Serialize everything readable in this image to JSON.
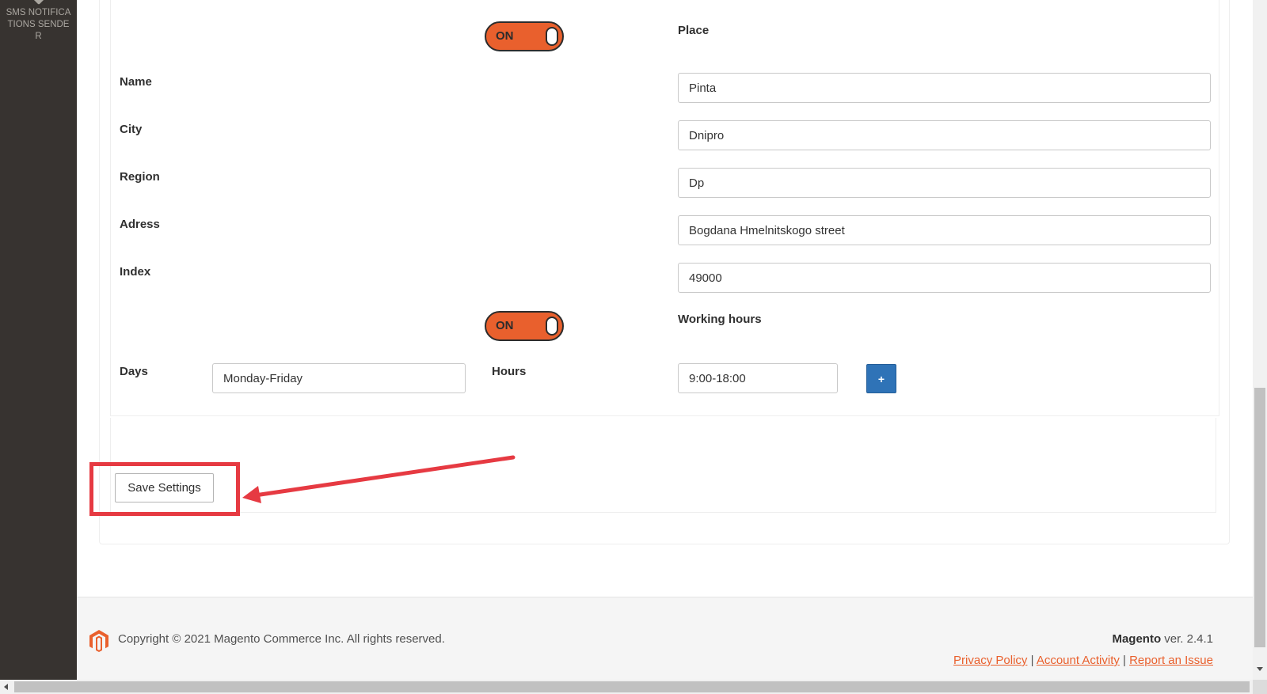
{
  "sidebar": {
    "items": [
      {
        "label": "SMS NOTIFICATIONS SENDER",
        "icon": "diamond-icon"
      }
    ]
  },
  "form": {
    "place_toggle": {
      "label": "ON",
      "state": "on"
    },
    "place_heading": "Place",
    "fields": [
      {
        "label": "Name",
        "value": "Pinta"
      },
      {
        "label": "City",
        "value": "Dnipro"
      },
      {
        "label": "Region",
        "value": "Dp"
      },
      {
        "label": "Adress",
        "value": "Bogdana Hmelnitskogo street"
      },
      {
        "label": "Index",
        "value": "49000"
      }
    ],
    "hours_toggle": {
      "label": "ON",
      "state": "on"
    },
    "hours_heading": "Working hours",
    "days_label": "Days",
    "days_value": "Monday-Friday",
    "hours_label": "Hours",
    "hours_value": "9:00-18:00",
    "add_label": "+"
  },
  "actions": {
    "save_label": "Save Settings"
  },
  "footer": {
    "copyright": "Copyright © 2021 Magento Commerce Inc. All rights reserved.",
    "brand": "Magento",
    "version": " ver. 2.4.1",
    "links": {
      "privacy": "Privacy Policy",
      "separator": " | ",
      "activity": "Account Activity",
      "report": "Report an Issue"
    }
  },
  "colors": {
    "sidebar_bg": "#373330",
    "toggle_on": "#e9602d",
    "primary_button": "#2f73b7",
    "link": "#e9602d",
    "annotation": "#e63a42"
  }
}
